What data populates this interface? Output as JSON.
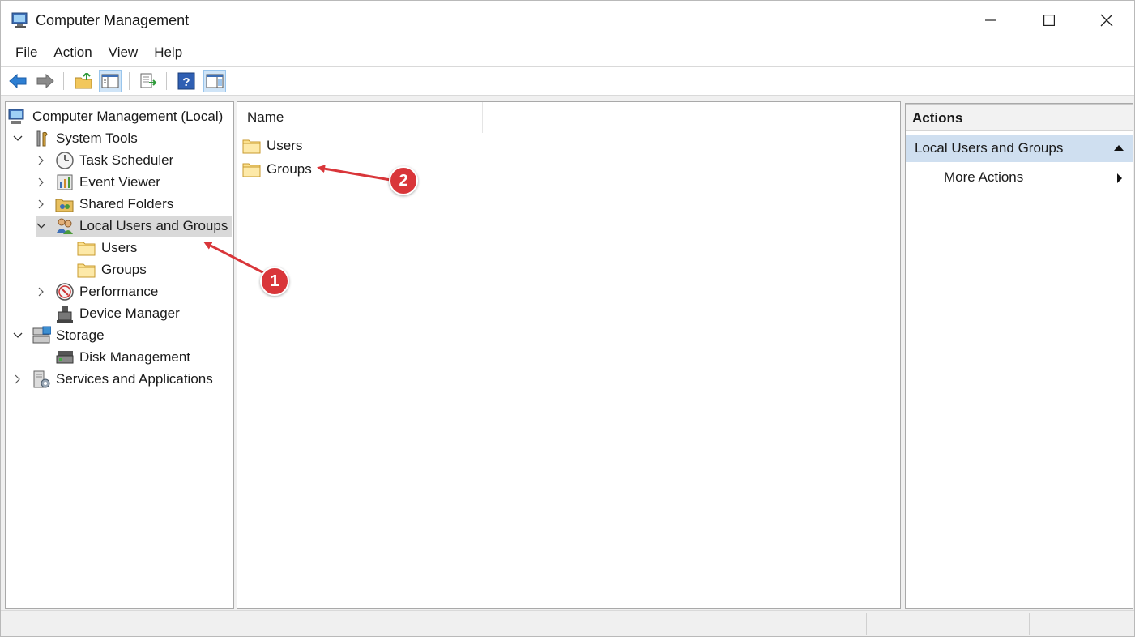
{
  "window": {
    "title": "Computer Management"
  },
  "menu": [
    "File",
    "Action",
    "View",
    "Help"
  ],
  "toolbar": {
    "buttons": [
      "back-icon",
      "forward-icon",
      "up-folder-icon",
      "show-hide-tree-icon",
      "export-list-icon",
      "help-icon",
      "show-hide-action-pane-icon"
    ]
  },
  "tree": {
    "items": [
      {
        "label": "Computer Management (Local)",
        "icon": "computer-management-icon"
      },
      {
        "label": "System Tools",
        "icon": "system-tools-icon",
        "expanded": true
      },
      {
        "label": "Task Scheduler",
        "icon": "task-scheduler-icon",
        "expanded": false
      },
      {
        "label": "Event Viewer",
        "icon": "event-viewer-icon",
        "expanded": false
      },
      {
        "label": "Shared Folders",
        "icon": "shared-folders-icon",
        "expanded": false
      },
      {
        "label": "Local Users and Groups",
        "icon": "local-users-groups-icon",
        "expanded": true,
        "selected": true
      },
      {
        "label": "Users",
        "icon": "folder-icon"
      },
      {
        "label": "Groups",
        "icon": "folder-icon"
      },
      {
        "label": "Performance",
        "icon": "performance-icon",
        "expanded": false
      },
      {
        "label": "Device Manager",
        "icon": "device-manager-icon"
      },
      {
        "label": "Storage",
        "icon": "storage-icon",
        "expanded": true
      },
      {
        "label": "Disk Management",
        "icon": "disk-management-icon"
      },
      {
        "label": "Services and Applications",
        "icon": "services-applications-icon",
        "expanded": false
      }
    ]
  },
  "list": {
    "column_header": "Name",
    "rows": [
      {
        "label": "Users",
        "icon": "folder-icon"
      },
      {
        "label": "Groups",
        "icon": "folder-icon"
      }
    ]
  },
  "actions": {
    "header": "Actions",
    "section": "Local Users and Groups",
    "items": [
      "More Actions"
    ]
  },
  "callouts": [
    "1",
    "2"
  ],
  "colors": {
    "callout": "#d9363a",
    "selection": "#d9d9d9",
    "action_section": "#cfdff0"
  }
}
